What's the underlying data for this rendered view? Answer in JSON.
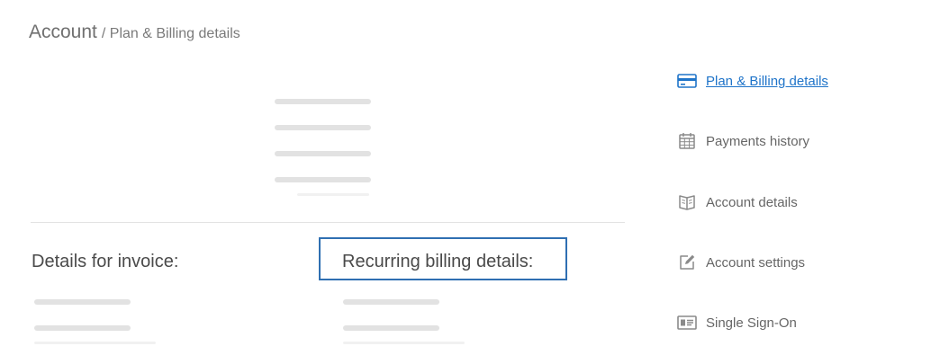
{
  "breadcrumb": {
    "root": "Account",
    "separator": "/",
    "current": "Plan & Billing details"
  },
  "sections": {
    "invoice_title": "Details for invoice:",
    "recurring_title": "Recurring billing details:"
  },
  "side_nav": {
    "items": [
      {
        "label": "Plan & Billing details",
        "icon": "credit-card-icon",
        "active": true
      },
      {
        "label": "Payments history",
        "icon": "calendar-icon",
        "active": false
      },
      {
        "label": "Account details",
        "icon": "book-icon",
        "active": false
      },
      {
        "label": "Account settings",
        "icon": "edit-icon",
        "active": false
      },
      {
        "label": "Single Sign-On",
        "icon": "id-card-icon",
        "active": false
      }
    ]
  },
  "colors": {
    "accent": "#1f74c9",
    "highlight_border": "#2f6fb2",
    "skeleton": "#e2e2e2",
    "text_muted": "#666666"
  }
}
